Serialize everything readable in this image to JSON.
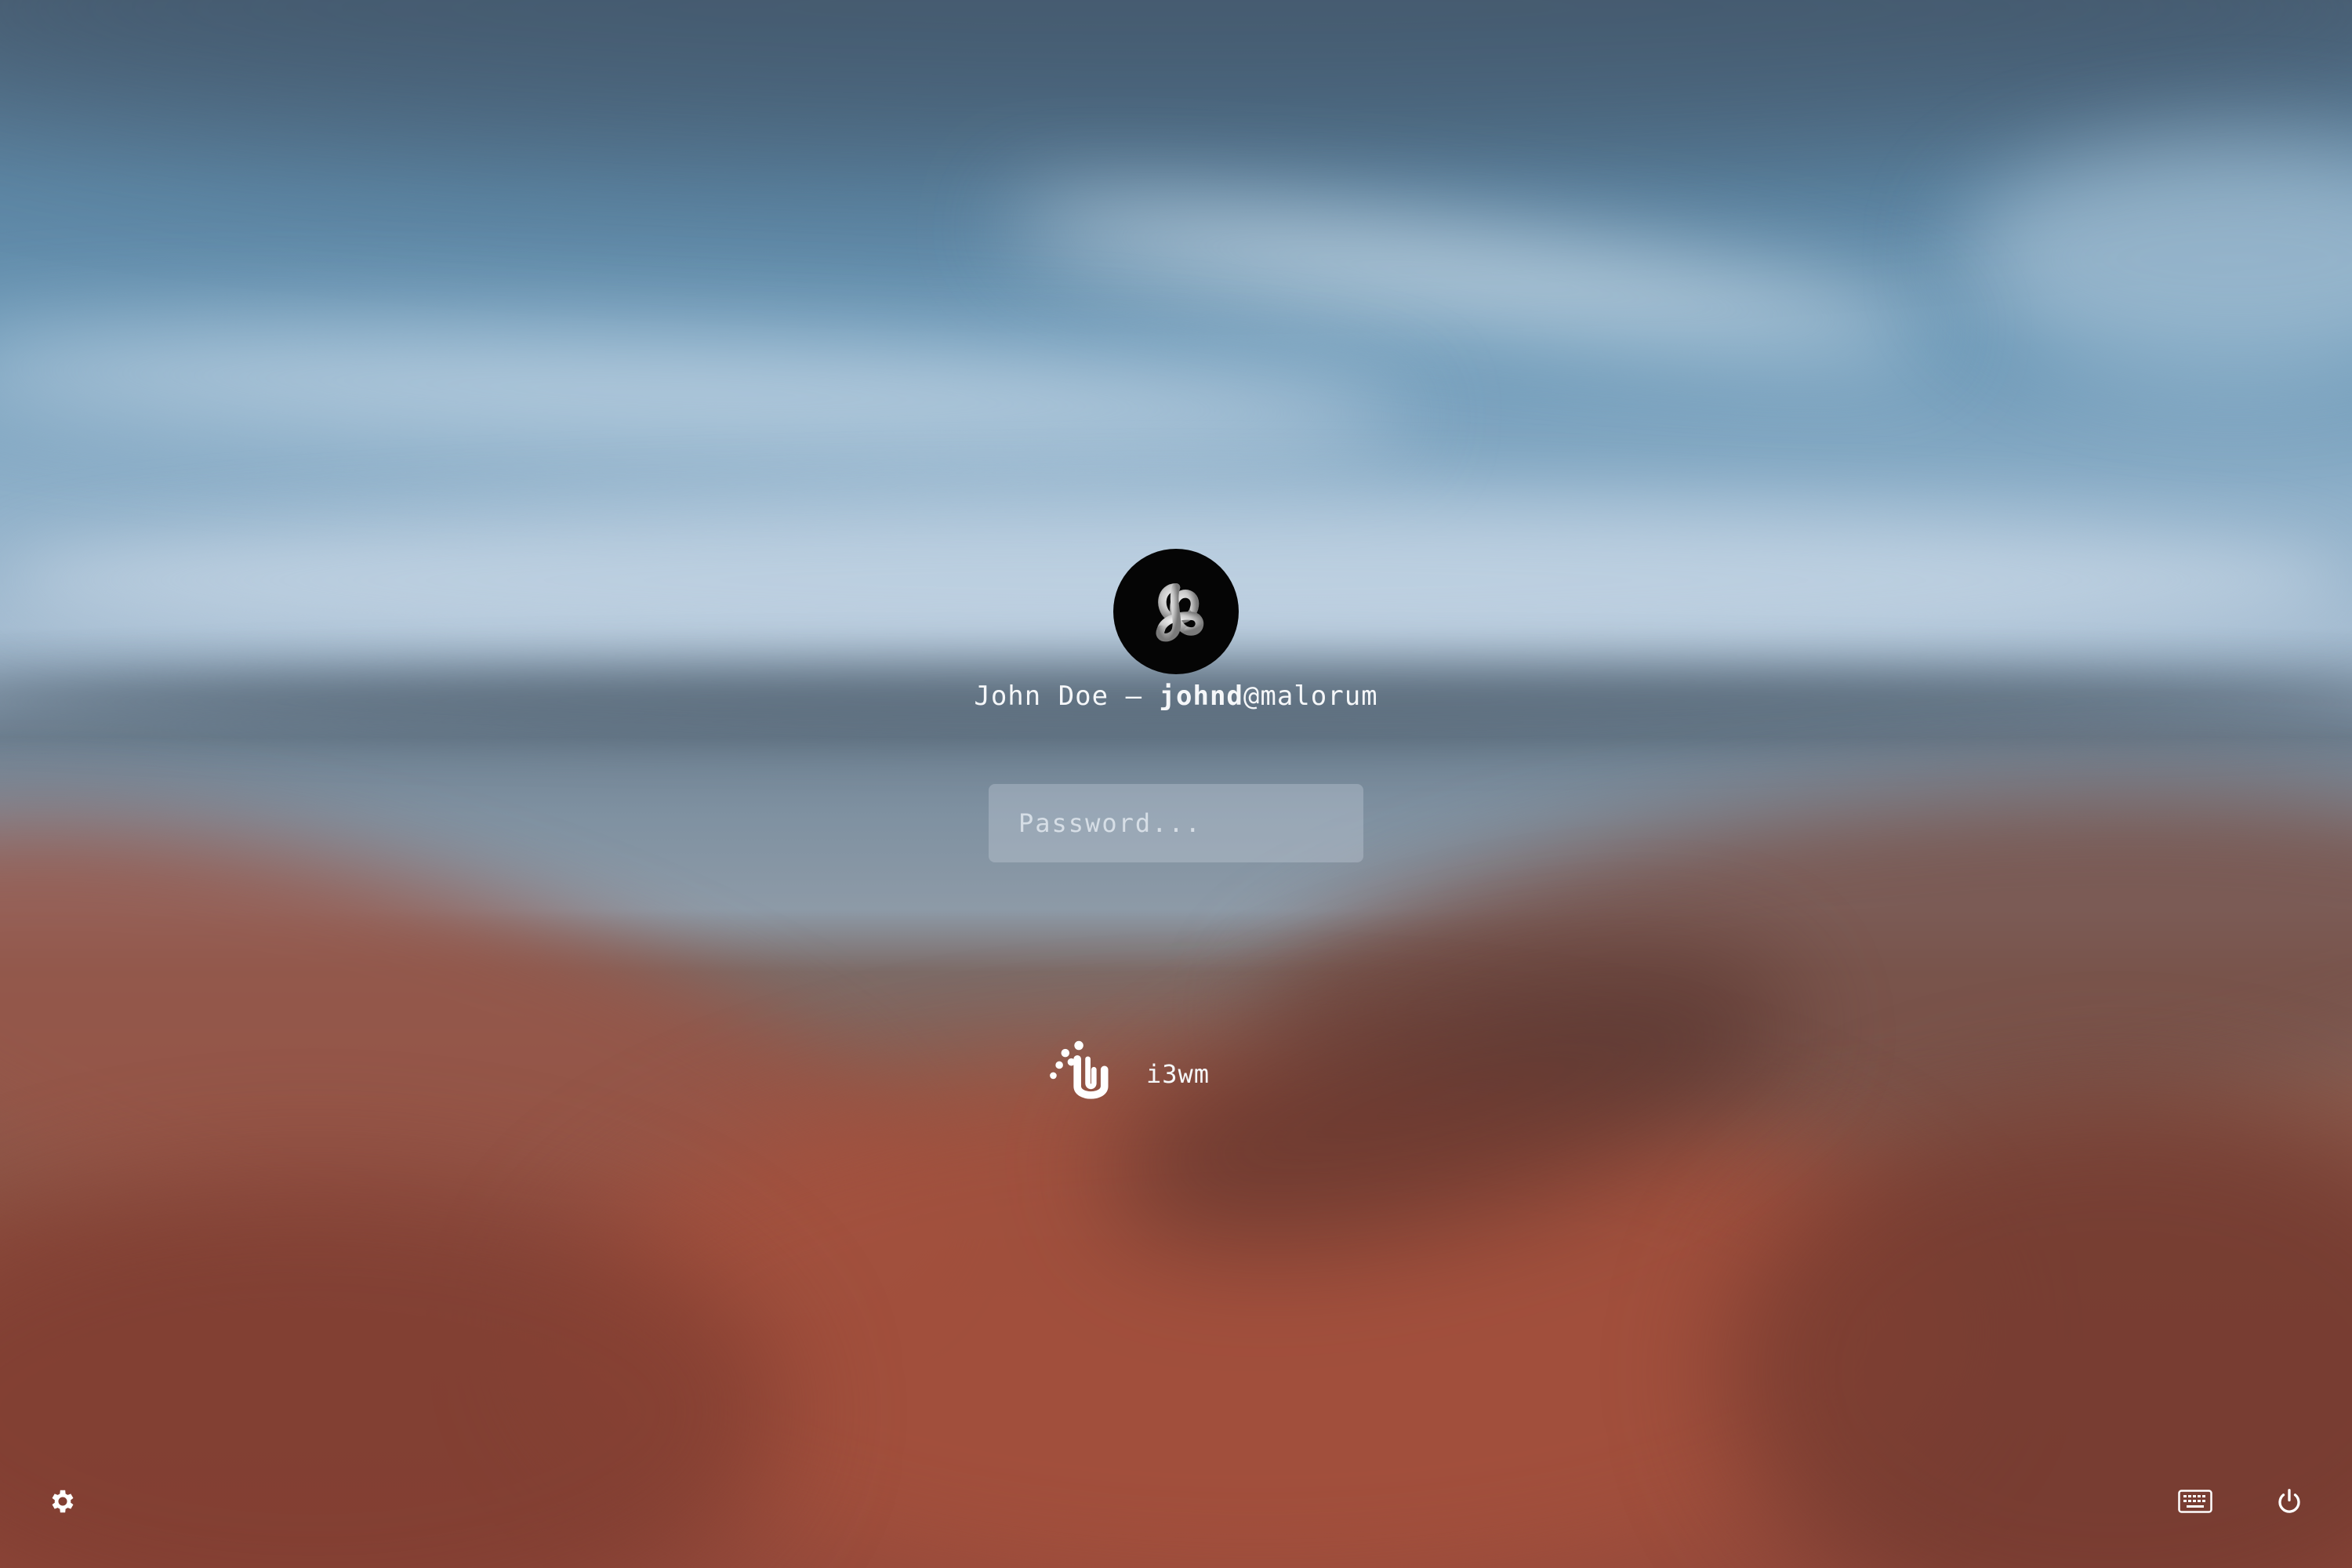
{
  "background": {
    "description_colors": {
      "sky_top": "#51697f",
      "sky_mid": "#6996b5",
      "horizon": "#7f91a1",
      "mountains": "#93493b"
    }
  },
  "user": {
    "full_name": "John Doe",
    "separator": " — ",
    "username": "johnd",
    "hostname": "@malorum",
    "avatar_icon": "trefoil-knot-icon"
  },
  "password": {
    "placeholder": "Password...",
    "value": ""
  },
  "session": {
    "label": "i3wm",
    "icon": "i3-logo-icon"
  },
  "bottom_bar": {
    "settings_icon": "gear-icon",
    "keyboard_icon": "keyboard-icon",
    "power_icon": "power-icon"
  },
  "colors": {
    "text": "#f5f7f9",
    "input_bg": "rgba(200,210,220,0.35)",
    "avatar_bg": "#050505"
  }
}
